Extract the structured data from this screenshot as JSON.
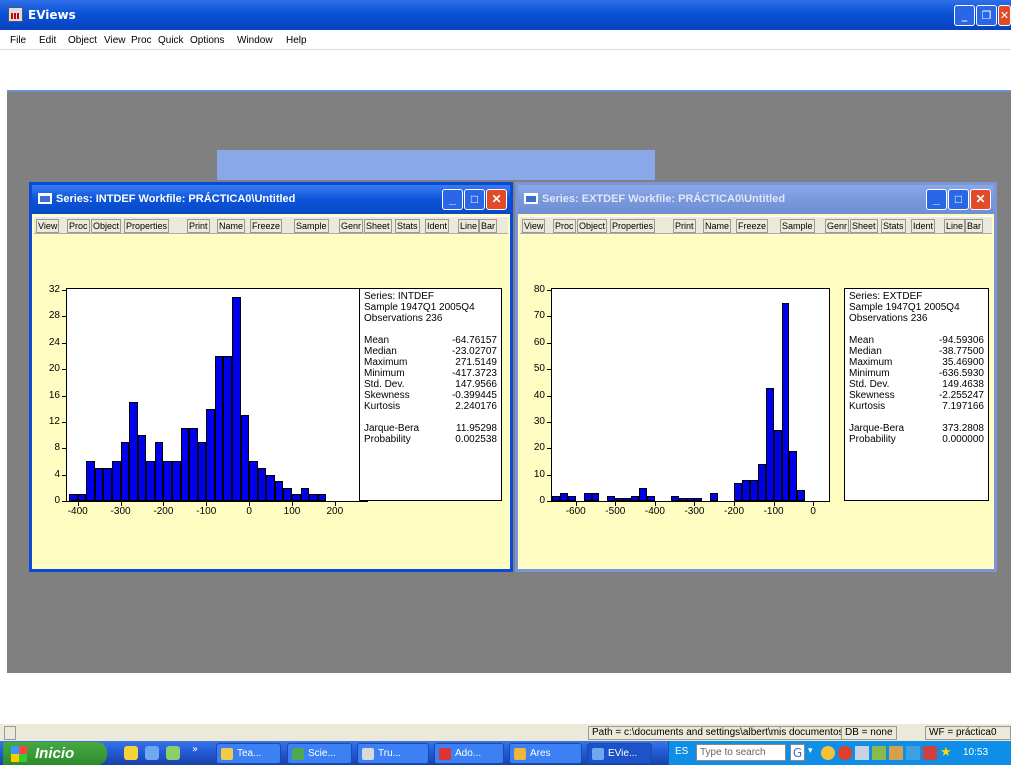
{
  "app": {
    "title": "EViews"
  },
  "menu": [
    "File",
    "Edit",
    "Object",
    "View",
    "Proc",
    "Quick",
    "Options",
    "Window",
    "Help"
  ],
  "windows": [
    {
      "title": "Series: INTDEF   Workfile: PRÁCTICA0\\Untitled",
      "toolbar": [
        "View",
        "Proc",
        "Object",
        "Properties",
        "Print",
        "Name",
        "Freeze",
        "Sample",
        "Genr",
        "Sheet",
        "Stats",
        "Ident",
        "Line",
        "Bar"
      ],
      "chart_data": {
        "type": "bar",
        "bin_width": 20,
        "bin_starts": [
          -420,
          -400,
          -380,
          -360,
          -340,
          -320,
          -300,
          -280,
          -260,
          -240,
          -220,
          -200,
          -180,
          -160,
          -140,
          -120,
          -100,
          -80,
          -60,
          -40,
          -20,
          0,
          20,
          40,
          60,
          80,
          100,
          120,
          140,
          160,
          180,
          200,
          220,
          240,
          260
        ],
        "values": [
          1,
          1,
          6,
          5,
          5,
          6,
          9,
          15,
          10,
          6,
          9,
          6,
          6,
          11,
          11,
          9,
          14,
          22,
          22,
          31,
          13,
          6,
          5,
          4,
          3,
          2,
          1,
          2,
          1,
          1,
          0,
          0,
          0,
          0,
          0
        ],
        "ylim": [
          0,
          32
        ],
        "yticks": [
          0,
          4,
          8,
          12,
          16,
          20,
          24,
          28,
          32
        ],
        "xticks": [
          -400,
          -300,
          -200,
          -100,
          0,
          100,
          200
        ],
        "xlim": [
          -425,
          275
        ]
      },
      "stats": {
        "header": [
          "Series: INTDEF",
          "Sample 1947Q1 2005Q4",
          "Observations 236"
        ],
        "rows": [
          [
            "Mean",
            "-64.76157"
          ],
          [
            "Median",
            "-23.02707"
          ],
          [
            "Maximum",
            "271.5149"
          ],
          [
            "Minimum",
            "-417.3723"
          ],
          [
            "Std. Dev.",
            "147.9566"
          ],
          [
            "Skewness",
            "-0.399445"
          ],
          [
            "Kurtosis",
            "2.240176"
          ]
        ],
        "test_rows": [
          [
            "Jarque-Bera",
            "11.95298"
          ],
          [
            "Probability",
            "0.002538"
          ]
        ]
      }
    },
    {
      "title": "Series: EXTDEF   Workfile: PRÁCTICA0\\Untitled",
      "toolbar": [
        "View",
        "Proc",
        "Object",
        "Properties",
        "Print",
        "Name",
        "Freeze",
        "Sample",
        "Genr",
        "Sheet",
        "Stats",
        "Ident",
        "Line",
        "Bar"
      ],
      "chart_data": {
        "type": "bar",
        "bin_width": 20,
        "bin_starts": [
          -660,
          -640,
          -620,
          -600,
          -580,
          -560,
          -540,
          -520,
          -500,
          -480,
          -460,
          -440,
          -420,
          -400,
          -380,
          -360,
          -340,
          -320,
          -300,
          -280,
          -260,
          -240,
          -220,
          -200,
          -180,
          -160,
          -140,
          -120,
          -100,
          -80,
          -60,
          -40,
          -20,
          0,
          20
        ],
        "values": [
          2,
          3,
          2,
          0,
          3,
          3,
          0,
          2,
          1,
          1,
          2,
          5,
          2,
          0,
          0,
          2,
          1,
          1,
          1,
          0,
          3,
          0,
          0,
          7,
          8,
          8,
          14,
          43,
          27,
          75,
          19,
          4,
          0,
          0,
          0
        ],
        "ylim": [
          0,
          80
        ],
        "yticks": [
          0,
          10,
          20,
          30,
          40,
          50,
          60,
          70,
          80
        ],
        "xticks": [
          -600,
          -500,
          -400,
          -300,
          -200,
          -100,
          0
        ],
        "xlim": [
          -660,
          40
        ]
      },
      "stats": {
        "header": [
          "Series: EXTDEF",
          "Sample 1947Q1 2005Q4",
          "Observations 236"
        ],
        "rows": [
          [
            "Mean",
            "-94.59306"
          ],
          [
            "Median",
            "-38.77500"
          ],
          [
            "Maximum",
            "35.46900"
          ],
          [
            "Minimum",
            "-636.5930"
          ],
          [
            "Std. Dev.",
            "149.4638"
          ],
          [
            "Skewness",
            "-2.255247"
          ],
          [
            "Kurtosis",
            "7.197166"
          ]
        ],
        "test_rows": [
          [
            "Jarque-Bera",
            "373.2808"
          ],
          [
            "Probability",
            "0.000000"
          ]
        ]
      }
    }
  ],
  "status": {
    "path": "Path = c:\\documents and settings\\albert\\mis documentos",
    "db": "DB = none",
    "wf": "WF = práctica0"
  },
  "taskbar": {
    "start": "Inicio",
    "tasks": [
      "Tea...",
      "Scie...",
      "Tru...",
      "Ado...",
      "Ares",
      "EVie..."
    ],
    "lang": "ES",
    "search_placeholder": "Type to search",
    "clock": "10:53"
  }
}
